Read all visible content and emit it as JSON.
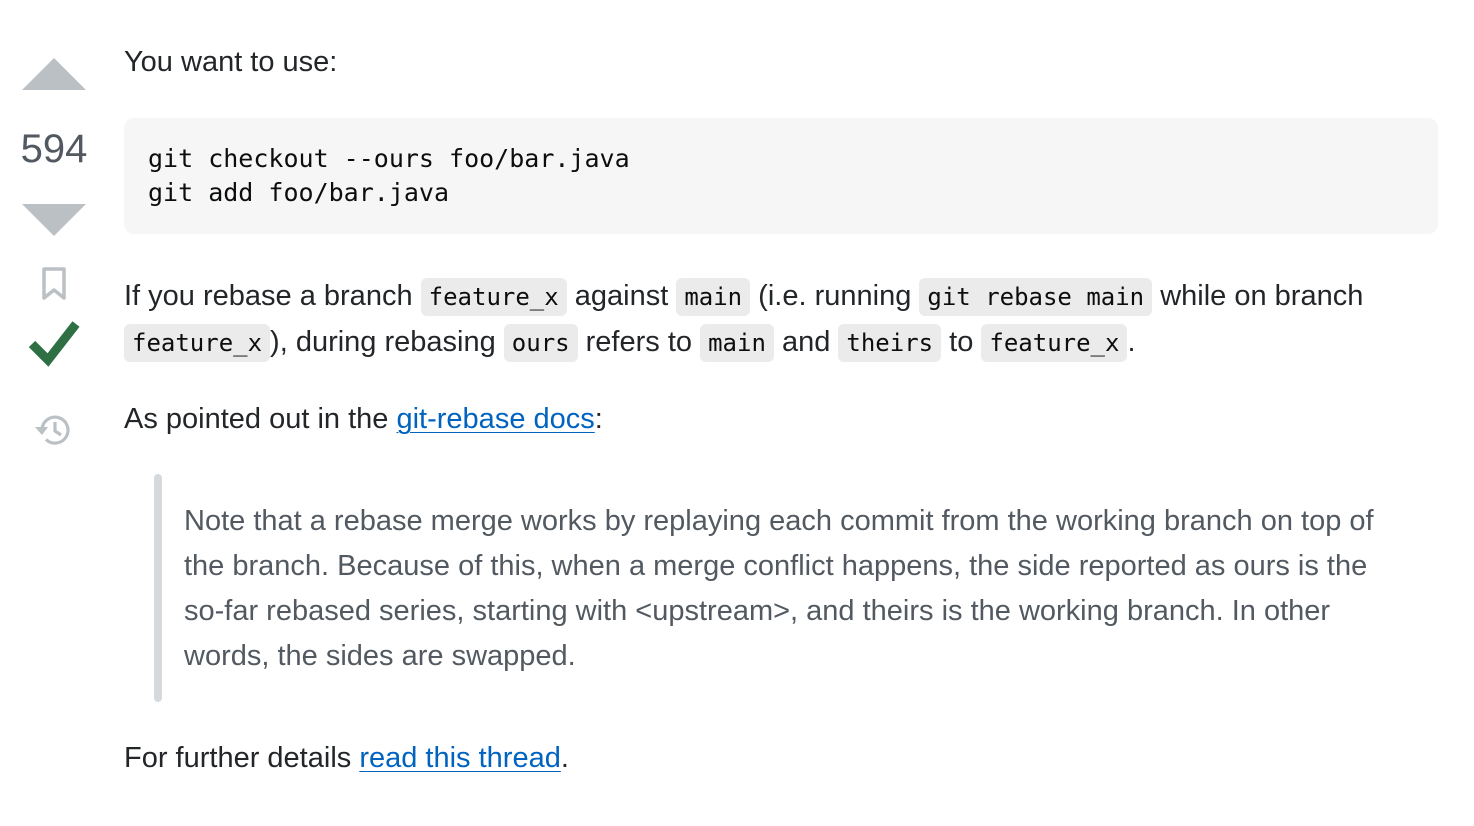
{
  "vote": {
    "count": "594"
  },
  "answer": {
    "intro": "You want to use:",
    "code_lines": [
      "git checkout --ours foo/bar.java",
      "git add foo/bar.java"
    ],
    "para2": {
      "t1": "If you rebase a branch ",
      "c1": "feature_x",
      "t2": " against ",
      "c2": "main",
      "t3": " (i.e. running ",
      "c3": "git rebase main",
      "t4": " while on branch ",
      "c4": "feature_x",
      "t5": "), during rebasing ",
      "c5": "ours",
      "t6": " refers to ",
      "c6": "main",
      "t7": " and ",
      "c7": "theirs",
      "t8": " to ",
      "c8": "feature_x",
      "t9": "."
    },
    "para3": {
      "t1": "As pointed out in the ",
      "link": "git-rebase docs",
      "t2": ":"
    },
    "blockquote": "Note that a rebase merge works by replaying each commit from the working branch on top of the branch. Because of this, when a merge conflict happens, the side reported as ours is the so-far rebased series, starting with <upstream>, and theirs is the working branch. In other words, the sides are swapped.",
    "para4": {
      "t1": "For further details ",
      "link": "read this thread",
      "t2": "."
    }
  },
  "colors": {
    "vote_arrow": "#bbc0c4",
    "accepted_check": "#2f6f44",
    "link": "#0063bf",
    "code_bg": "#f6f6f6",
    "inline_code_bg": "#ebebeb",
    "quote_bar": "#d6d9dc"
  },
  "icons": {
    "upvote": "upvote-arrow-icon",
    "downvote": "downvote-arrow-icon",
    "bookmark": "bookmark-icon",
    "accepted": "accepted-checkmark-icon",
    "history": "history-icon"
  }
}
